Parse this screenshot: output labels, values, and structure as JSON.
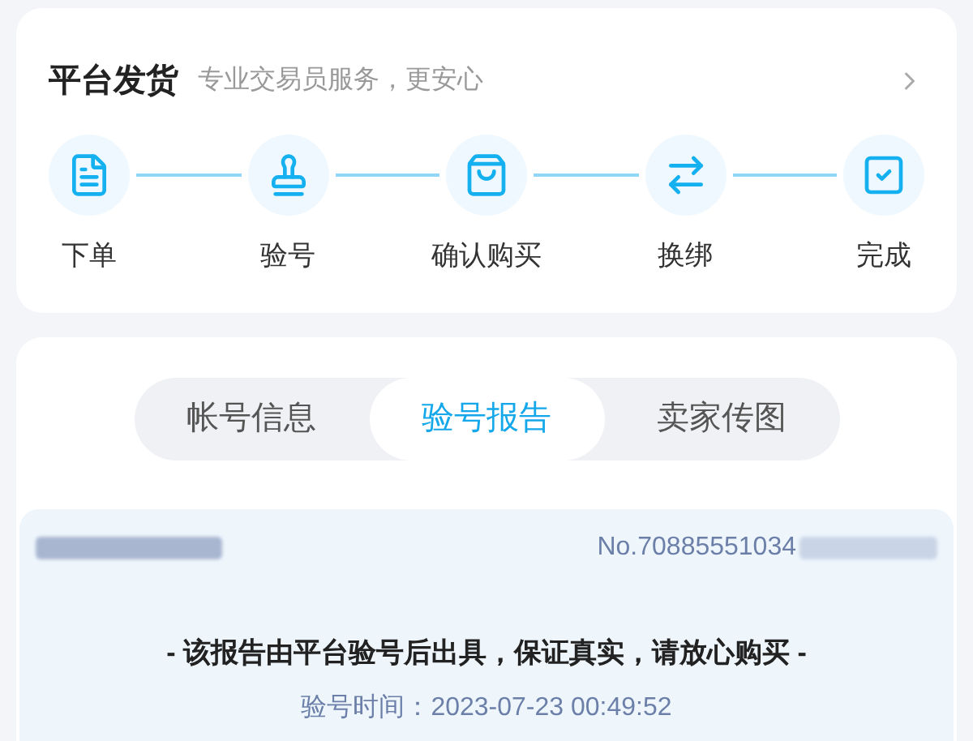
{
  "delivery": {
    "title": "平台发货",
    "subtitle": "专业交易员服务，更安心",
    "steps": [
      {
        "label": "下单",
        "kind": "order"
      },
      {
        "label": "验号",
        "kind": "stamp"
      },
      {
        "label": "确认购买",
        "kind": "bag"
      },
      {
        "label": "换绑",
        "kind": "swap"
      },
      {
        "label": "完成",
        "kind": "done"
      }
    ]
  },
  "tabs": [
    {
      "label": "帐号信息",
      "selected": false
    },
    {
      "label": "验号报告",
      "selected": true
    },
    {
      "label": "卖家传图",
      "selected": false
    }
  ],
  "report": {
    "number": "No.70885551034",
    "notice": "- 该报告由平台验号后出具，保证真实，请放心购买 -",
    "time_label": "验号时间：",
    "time": "2023-07-23 00:49:52"
  }
}
